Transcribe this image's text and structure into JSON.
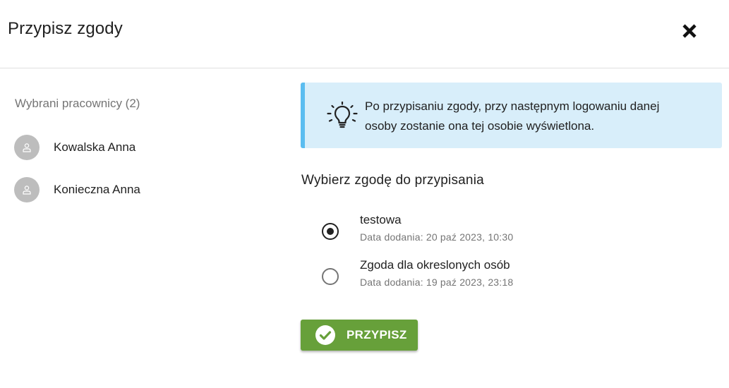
{
  "dialog": {
    "title": "Przypisz zgody",
    "close_icon": "close-icon"
  },
  "employees": {
    "heading": "Wybrani pracownicy (2)",
    "items": [
      {
        "name": "Kowalska Anna",
        "avatar_icon": "person-icon"
      },
      {
        "name": "Konieczna Anna",
        "avatar_icon": "person-icon"
      }
    ]
  },
  "info": {
    "icon": "lightbulb-icon",
    "text": "Po przypisaniu zgody, przy następnym logowaniu danej osoby zostanie ona tej osobie wyświetlona."
  },
  "consents": {
    "heading": "Wybierz zgodę do przypisania",
    "options": [
      {
        "title": "testowa",
        "date": "Data dodania: 20 paź 2023, 10:30",
        "selected": true
      },
      {
        "title": "Zgoda dla okreslonych osób",
        "date": "Data dodania: 19 paź 2023, 23:18",
        "selected": false
      }
    ]
  },
  "actions": {
    "assign_label": "PRZYPISZ",
    "assign_icon": "check-circle-icon"
  },
  "colors": {
    "accent_green": "#67a03a",
    "info_background": "#d8eefa",
    "info_border": "#5bbdf0",
    "avatar_gray": "#bdbdbd"
  }
}
